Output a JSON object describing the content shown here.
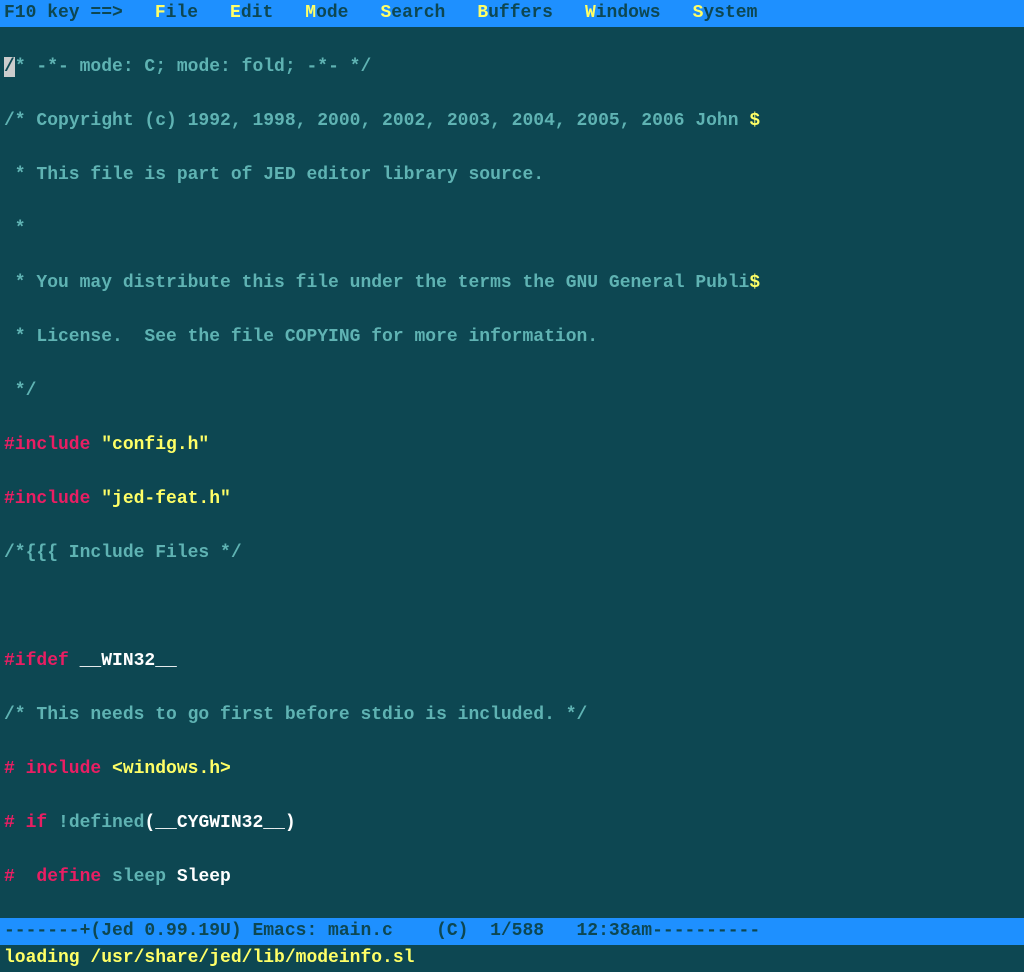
{
  "menubar": {
    "key_hint": "F10 key ==>",
    "items": [
      {
        "hotkey": "F",
        "rest": "ile"
      },
      {
        "hotkey": "E",
        "rest": "dit"
      },
      {
        "hotkey": "M",
        "rest": "ode"
      },
      {
        "hotkey": "S",
        "rest": "earch"
      },
      {
        "hotkey": "B",
        "rest": "uffers"
      },
      {
        "hotkey": "W",
        "rest": "indows"
      },
      {
        "hotkey": "S",
        "rest": "ystem"
      }
    ]
  },
  "code": {
    "line1_cursor": "/",
    "line1_rest": "* -*- mode: C; mode: fold; -*- */",
    "line2_start": "/* Copyright (c) 1992, 1998, 2000, 2002, 2003, 2004, 2005, 2006 John ",
    "line2_trunc": "$",
    "line3": " * This file is part of JED editor library source.",
    "line4": " *",
    "line5_start": " * You may distribute this file under the terms the GNU General Publi",
    "line5_trunc": "$",
    "line6": " * License.  See the file COPYING for more information.",
    "line7": " */",
    "line8_dir": "#include ",
    "line8_str": "\"config.h\"",
    "line9_dir": "#include ",
    "line9_str": "\"jed-feat.h\"",
    "line10": "/*{{{ Include Files */",
    "line11": "",
    "line12_dir": "#ifdef ",
    "line12_macro": "__WIN32__",
    "line13": "/* This needs to go first before stdio is included. */",
    "line14_dir": "# include ",
    "line14_str": "<windows.h>",
    "line15_dir": "# if ",
    "line15_kw": "!defined",
    "line15_paren1": "(",
    "line15_macro": "__CYGWIN32__",
    "line15_paren2": ")",
    "line16_dir": "#  define ",
    "line16_id1": "sleep ",
    "line16_id2": "Sleep"
  },
  "statusbar": {
    "text": "-------+(Jed 0.99.19U) Emacs: main.c    (C)  1/588   12:38am----------"
  },
  "footer": {
    "text": "loading /usr/share/jed/lib/modeinfo.sl"
  }
}
